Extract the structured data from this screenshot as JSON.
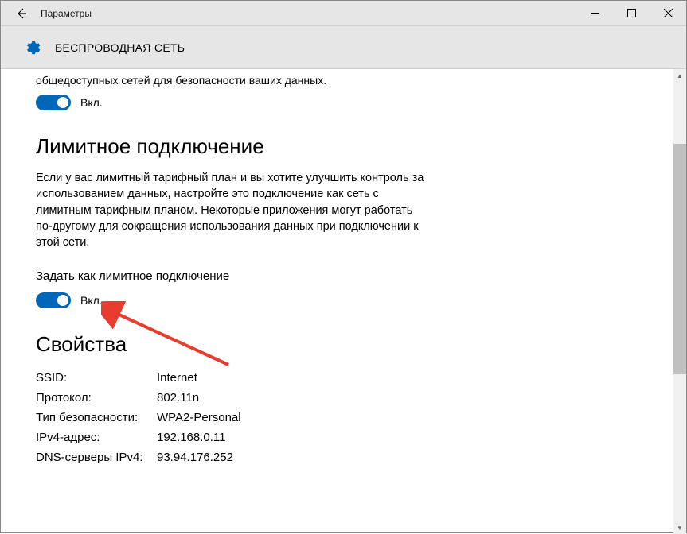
{
  "window": {
    "title": "Параметры"
  },
  "page": {
    "title": "БЕСПРОВОДНАЯ СЕТЬ"
  },
  "truncated_text": "общедоступных сетей для безопасности ваших данных.",
  "toggle1": {
    "label": "Вкл.",
    "state": "on"
  },
  "section_metered": {
    "heading": "Лимитное подключение",
    "description": "Если у вас лимитный тарифный план и вы хотите улучшить контроль за использованием данных, настройте это подключение как сеть с лимитным тарифным планом. Некоторые приложения могут работать по-другому для сокращения использования данных при подключении к этой сети.",
    "sub_label": "Задать как лимитное подключение",
    "toggle": {
      "label": "Вкл.",
      "state": "on"
    }
  },
  "section_props": {
    "heading": "Свойства",
    "rows": [
      {
        "label": "SSID:",
        "value": "Internet"
      },
      {
        "label": "Протокол:",
        "value": "802.11n"
      },
      {
        "label": "Тип безопасности:",
        "value": "WPA2-Personal"
      },
      {
        "label": "IPv4-адрес:",
        "value": "192.168.0.11"
      },
      {
        "label": "DNS-серверы IPv4:",
        "value": "93.94.176.252"
      }
    ]
  }
}
